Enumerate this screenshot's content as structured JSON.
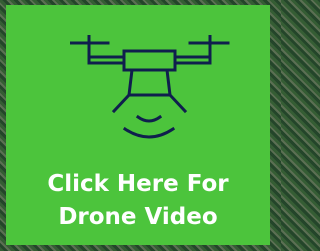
{
  "link": {
    "line1": "Click Here For",
    "line2": "Drone Video",
    "icon": "drone-icon"
  },
  "colors": {
    "tile_background": "#4cc43c",
    "icon_stroke": "#0f1f4d",
    "text": "#ffffff"
  }
}
